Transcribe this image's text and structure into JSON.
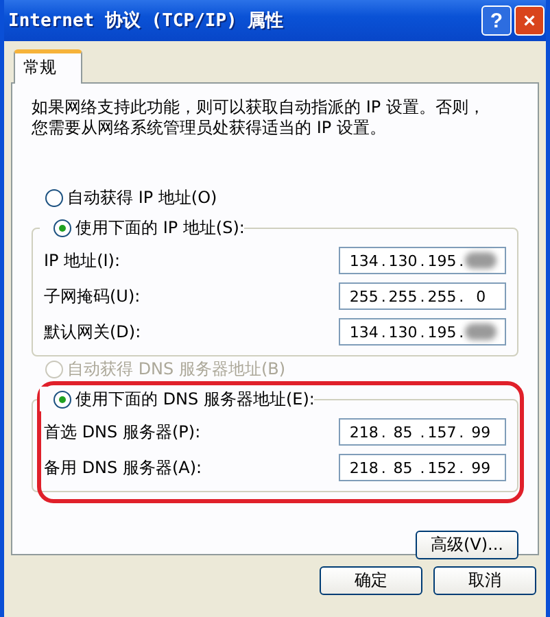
{
  "window": {
    "title": "Internet 协议 (TCP/IP) 属性"
  },
  "title_buttons": [
    {
      "kind": "help",
      "label": "?"
    },
    {
      "kind": "close",
      "label": "×"
    }
  ],
  "tabs": [
    {
      "label": "常规",
      "selected": true
    }
  ],
  "description": "如果网络支持此功能，则可以获取自动指派的 IP 设置。否则，您需要从网络系统管理员处获得适当的 IP 设置。",
  "ip_section": {
    "options": [
      {
        "label": "自动获得 IP 地址(O)",
        "selected": false,
        "disabled": false
      },
      {
        "label": "使用下面的 IP 地址(S):",
        "selected": true,
        "disabled": false
      }
    ],
    "separator": ".",
    "fields": [
      {
        "label": "IP 地址(I):",
        "octets": [
          {
            "text": "134"
          },
          {
            "text": "130"
          },
          {
            "text": "195"
          },
          {
            "blurred": true
          }
        ]
      },
      {
        "label": "子网掩码(U):",
        "octets": [
          {
            "text": "255"
          },
          {
            "text": "255"
          },
          {
            "text": "255"
          },
          {
            "text": "0"
          }
        ]
      },
      {
        "label": "默认网关(D):",
        "octets": [
          {
            "text": "134"
          },
          {
            "text": "130"
          },
          {
            "text": "195"
          },
          {
            "blurred": true
          }
        ]
      }
    ]
  },
  "dns_section": {
    "highlight": true,
    "options": [
      {
        "label": "自动获得 DNS 服务器地址(B)",
        "selected": false,
        "disabled": true
      },
      {
        "label": "使用下面的 DNS 服务器地址(E):",
        "selected": true,
        "disabled": false
      }
    ],
    "separator": ".",
    "fields": [
      {
        "label": "首选 DNS 服务器(P):",
        "octets": [
          {
            "text": "218"
          },
          {
            "text": "85"
          },
          {
            "text": "157"
          },
          {
            "text": "99"
          }
        ]
      },
      {
        "label": "备用 DNS 服务器(A):",
        "octets": [
          {
            "text": "218"
          },
          {
            "text": "85"
          },
          {
            "text": "152"
          },
          {
            "text": "99"
          }
        ]
      }
    ]
  },
  "advanced_button": "高级(V)...",
  "buttons": [
    "确定",
    "取消"
  ]
}
